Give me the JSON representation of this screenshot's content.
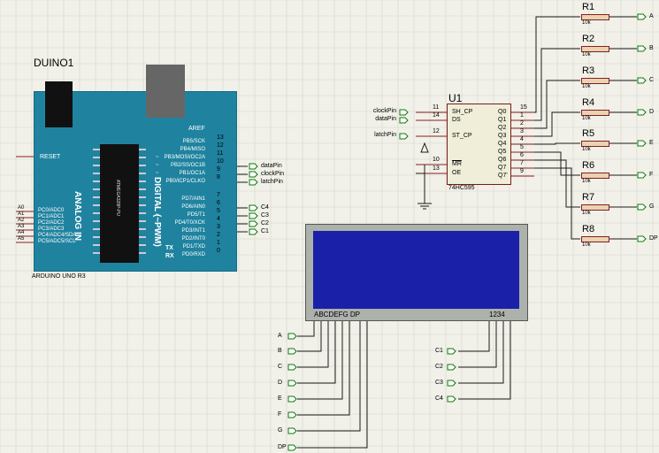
{
  "arduino": {
    "label": "DUINO1",
    "part": "ARDUINO UNO R3",
    "reset": "RESET",
    "aref": "AREF",
    "analog_title": "ANALOG IN",
    "digital_title": "DIGITAL (~PWM)",
    "tx": "TX",
    "rx": "RX",
    "chip_text": "ATMEGA328P-PU",
    "analog_pins": [
      {
        "ext": "A0",
        "name": "PC0/ADC0"
      },
      {
        "ext": "A1",
        "name": "PC1/ADC1"
      },
      {
        "ext": "A2",
        "name": "PC2/ADC2"
      },
      {
        "ext": "A3",
        "name": "PC3/ADC3"
      },
      {
        "ext": "A4",
        "name": "PC4/ADC4/SDA"
      },
      {
        "ext": "A5",
        "name": "PC5/ADC5/SCL"
      }
    ],
    "digital_pins": [
      {
        "num": "13",
        "name": "PB5/SCK",
        "tilde": false,
        "net": ""
      },
      {
        "num": "12",
        "name": "PB4/MISO",
        "tilde": false,
        "net": ""
      },
      {
        "num": "11",
        "name": "PB3/MOSI/OC2A",
        "tilde": true,
        "net": ""
      },
      {
        "num": "10",
        "name": "PB2/SS/OC1B",
        "tilde": true,
        "net": "dataPin"
      },
      {
        "num": "9",
        "name": "PB1/OC1A",
        "tilde": true,
        "net": "clockPin"
      },
      {
        "num": "8",
        "name": "PB0/ICP1/CLKO",
        "tilde": false,
        "net": "latchPin"
      },
      {
        "num": "7",
        "name": "PD7/AIN1",
        "tilde": false,
        "net": ""
      },
      {
        "num": "6",
        "name": "PD6/AIN0",
        "tilde": true,
        "net": "C4"
      },
      {
        "num": "5",
        "name": "PD5/T1",
        "tilde": true,
        "net": "C3"
      },
      {
        "num": "4",
        "name": "PD4/T0/XCK",
        "tilde": false,
        "net": "C2"
      },
      {
        "num": "3",
        "name": "PD3/INT1",
        "tilde": true,
        "net": "C1"
      },
      {
        "num": "2",
        "name": "PD2/INT0",
        "tilde": false,
        "net": ""
      },
      {
        "num": "1",
        "name": "PD1/TXD",
        "tilde": false,
        "net": ""
      },
      {
        "num": "0",
        "name": "PD0/RXD",
        "tilde": false,
        "net": ""
      }
    ]
  },
  "shift_register": {
    "label": "U1",
    "part": "74HC595",
    "inputs": [
      {
        "net": "clockPin",
        "num": "11",
        "name": "SH_CP"
      },
      {
        "net": "dataPin",
        "num": "14",
        "name": "DS"
      },
      {
        "net": "latchPin",
        "num": "12",
        "name": "ST_CP"
      },
      {
        "net": "",
        "num": "10",
        "name": "MR"
      },
      {
        "net": "",
        "num": "13",
        "name": "OE"
      }
    ],
    "outputs": [
      {
        "num": "15",
        "name": "Q0"
      },
      {
        "num": "1",
        "name": "Q1"
      },
      {
        "num": "2",
        "name": "Q2"
      },
      {
        "num": "3",
        "name": "Q3"
      },
      {
        "num": "4",
        "name": "Q4"
      },
      {
        "num": "5",
        "name": "Q5"
      },
      {
        "num": "6",
        "name": "Q6"
      },
      {
        "num": "7",
        "name": "Q7"
      },
      {
        "num": "9",
        "name": "Q7'"
      }
    ]
  },
  "resistors": [
    {
      "ref": "R1",
      "value": "10k",
      "net": "A"
    },
    {
      "ref": "R2",
      "value": "10k",
      "net": "B"
    },
    {
      "ref": "R3",
      "value": "10k",
      "net": "C"
    },
    {
      "ref": "R4",
      "value": "10k",
      "net": "D"
    },
    {
      "ref": "R5",
      "value": "10k",
      "net": "E"
    },
    {
      "ref": "R6",
      "value": "10k",
      "net": "F"
    },
    {
      "ref": "R7",
      "value": "10k",
      "net": "G"
    },
    {
      "ref": "R8",
      "value": "10k",
      "net": "DP"
    }
  ],
  "display": {
    "segments_label": "ABCDEFG  DP",
    "digits_label": "1234"
  },
  "segment_terminals": [
    "A",
    "B",
    "C",
    "D",
    "E",
    "F",
    "G",
    "DP"
  ],
  "digit_terminals": [
    "C1",
    "C2",
    "C3",
    "C4"
  ],
  "colors": {
    "background": "#f1f1e9",
    "grid": "#d6d6cc",
    "wire": "#1a1a1a",
    "pin_red": "#8a1d1d",
    "board": "#1f83a0",
    "lcd": "#1a21a8",
    "terminal": "#0a7a0a"
  }
}
